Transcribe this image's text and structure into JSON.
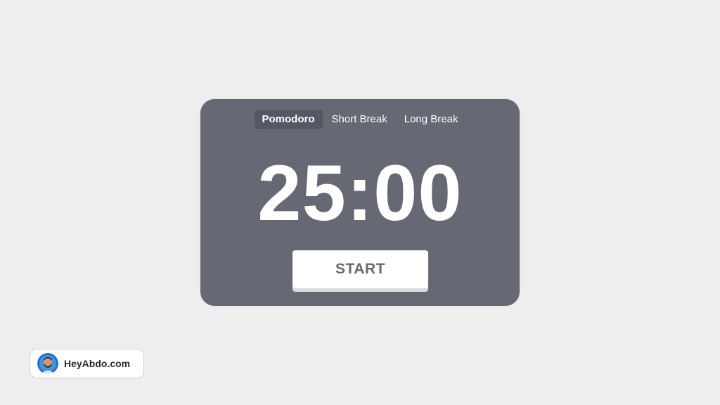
{
  "timer": {
    "tabs": [
      {
        "label": "Pomodoro",
        "active": true
      },
      {
        "label": "Short Break",
        "active": false
      },
      {
        "label": "Long Break",
        "active": false
      }
    ],
    "time": "25:00",
    "start_label": "START"
  },
  "brand": {
    "label": "HeyAbdo.com",
    "avatar_icon": "avatar-photo"
  },
  "colors": {
    "background": "#eeeeee",
    "card": "#666873",
    "active_tab": "#555765",
    "text": "#ffffff",
    "button_text": "#666873"
  }
}
